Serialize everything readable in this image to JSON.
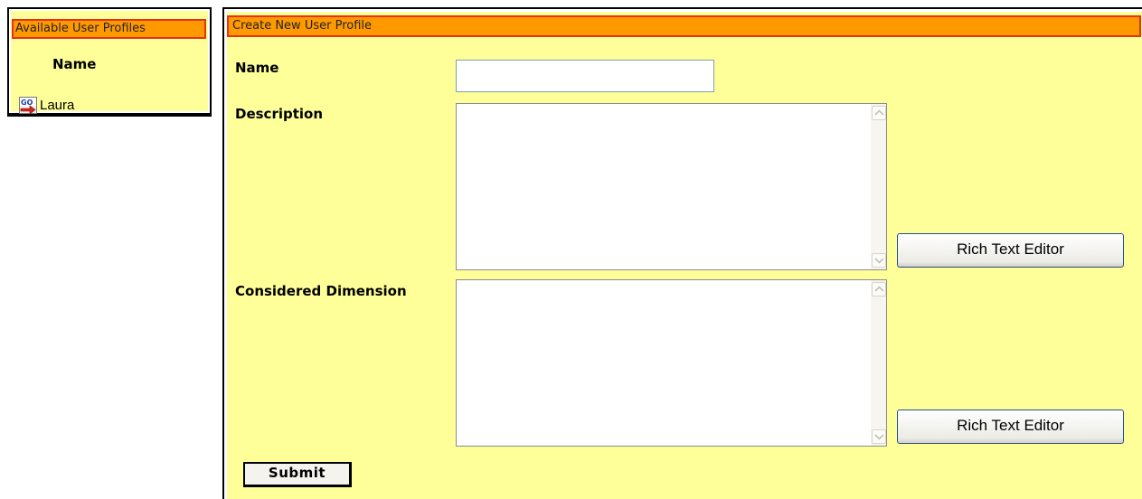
{
  "profiles_panel": {
    "title": "Available User Profiles",
    "column_header": "Name",
    "items": [
      {
        "name": "Laura",
        "icon": "go-icon"
      }
    ]
  },
  "create_panel": {
    "title": "Create New User Profile",
    "fields": {
      "name": {
        "label": "Name",
        "value": ""
      },
      "description": {
        "label": "Description",
        "value": "",
        "button_label": "Rich Text Editor"
      },
      "considered_dimension": {
        "label": "Considered Dimension",
        "value": "",
        "button_label": "Rich Text Editor"
      }
    },
    "submit_label": "Submit"
  },
  "colors": {
    "panel_background": "#ffff99",
    "header_background": "#ff9900",
    "header_border": "#e8301e"
  }
}
